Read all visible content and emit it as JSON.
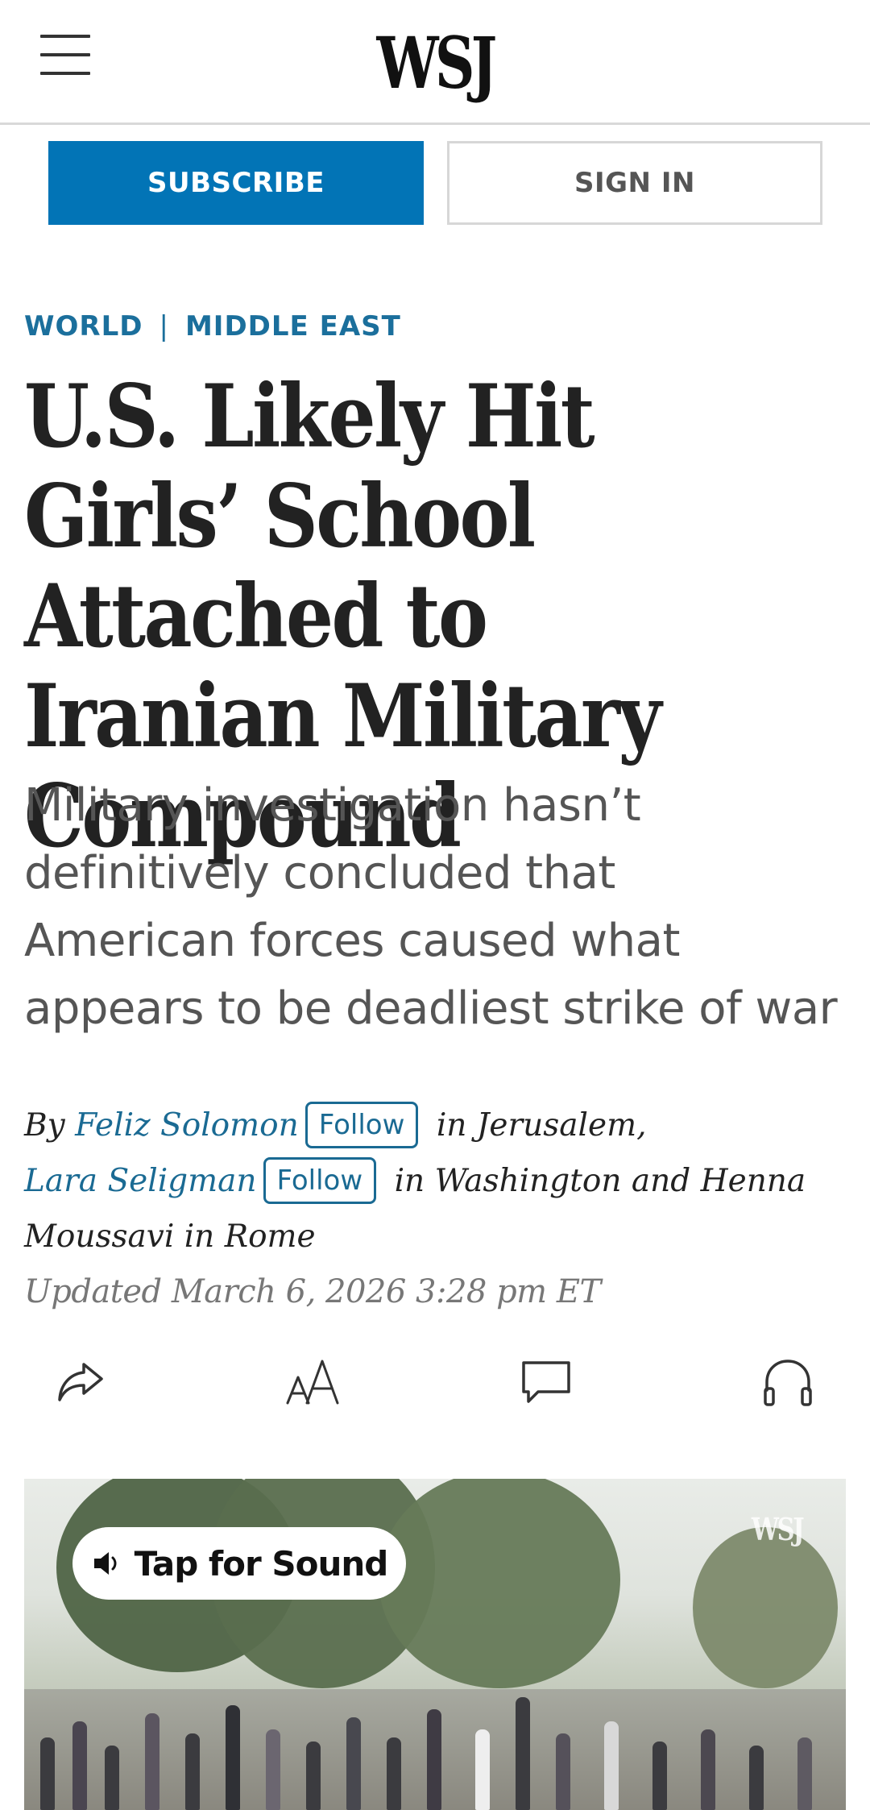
{
  "header": {
    "logo": "WSJ"
  },
  "auth": {
    "subscribe_label": "SUBSCRIBE",
    "signin_label": "SIGN IN"
  },
  "section": {
    "primary": "WORLD",
    "separator": "|",
    "secondary": "MIDDLE EAST"
  },
  "article": {
    "headline": "U.S. Likely Hit Girls’ School Attached to Iranian Military Compound",
    "dek": "Military investigation hasn’t definitively concluded that American forces caused what appears to be deadliest strike of war",
    "byline": {
      "by": "By",
      "author1": "Feliz Solomon",
      "follow1": "Follow",
      "location1": "in Jerusalem,",
      "author2": "Lara Seligman",
      "follow2": "Follow",
      "location2": "in Washington and Henna Moussavi in Rome"
    },
    "updated": "Updated March 6, 2026 3:28 pm ET"
  },
  "tools": {
    "icons": [
      "share-icon",
      "text-size-icon",
      "comment-icon",
      "headphones-icon"
    ]
  },
  "video": {
    "sound_label": "Tap for Sound",
    "watermark": "WSJ"
  },
  "colors": {
    "brand_blue": "#0274b6",
    "section_blue": "#1b6f9c",
    "link_blue": "#1a6a93"
  }
}
